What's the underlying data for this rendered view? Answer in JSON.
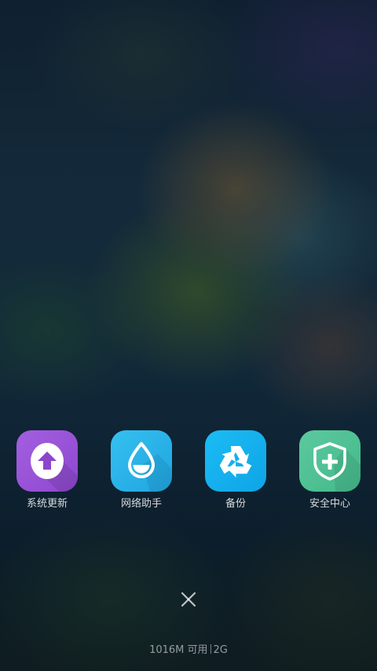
{
  "recent_apps": [
    {
      "label": "系统更新",
      "icon": "system-update-icon",
      "color": "#9a56d9"
    },
    {
      "label": "网络助手",
      "icon": "network-assistant-icon",
      "color": "#29b6ea"
    },
    {
      "label": "备份",
      "icon": "backup-recycle-icon",
      "color": "#1fb1ee"
    },
    {
      "label": "安全中心",
      "icon": "security-center-icon",
      "color": "#4fc195"
    }
  ],
  "close_all": {
    "icon": "close-icon"
  },
  "memory_status": {
    "available": "1016M 可用",
    "total": "2G"
  }
}
